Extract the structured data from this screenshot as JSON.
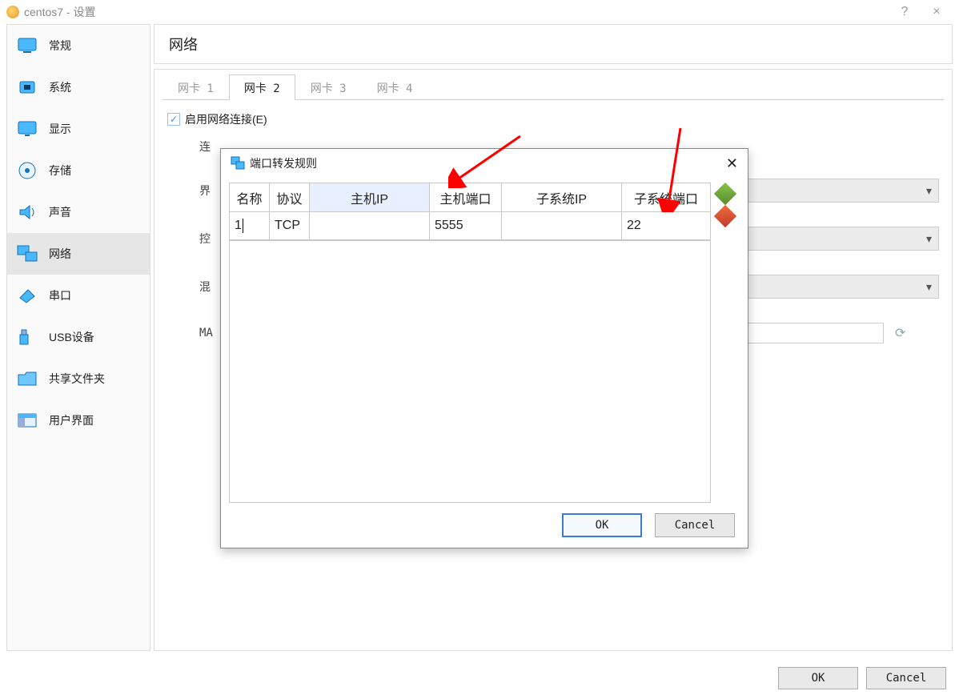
{
  "window": {
    "title": "centos7 - 设置",
    "help_tooltip": "?",
    "close_tooltip": "×"
  },
  "sidebar": {
    "items": [
      {
        "label": "常规"
      },
      {
        "label": "系统"
      },
      {
        "label": "显示"
      },
      {
        "label": "存储"
      },
      {
        "label": "声音"
      },
      {
        "label": "网络"
      },
      {
        "label": "串口"
      },
      {
        "label": "USB设备"
      },
      {
        "label": "共享文件夹"
      },
      {
        "label": "用户界面"
      }
    ]
  },
  "content": {
    "header": "网络",
    "tabs": [
      "网卡 1",
      "网卡 2",
      "网卡 3",
      "网卡 4"
    ],
    "active_tab": 1,
    "enable_label": "启用网络连接(E)",
    "partial_labels": [
      "连",
      "界",
      "控",
      "混",
      "MA"
    ]
  },
  "dialog": {
    "title": "端口转发规则",
    "columns": [
      "名称",
      "协议",
      "主机IP",
      "主机端口",
      "子系统IP",
      "子系统端口"
    ],
    "rows": [
      {
        "name": "1",
        "proto": "TCP",
        "hostip": "",
        "hostport": "5555",
        "guestip": "",
        "guestport": "22"
      }
    ],
    "ok": "OK",
    "cancel": "Cancel"
  },
  "footer": {
    "ok": "OK",
    "cancel": "Cancel"
  }
}
